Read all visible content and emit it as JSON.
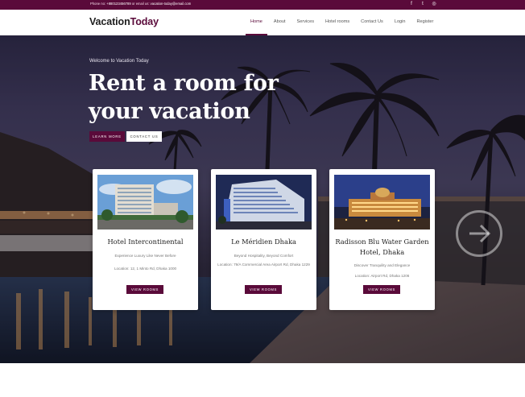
{
  "topbar": {
    "phone_label": "Phone no:",
    "phone": "+880123456789",
    "email_label": "or email us:",
    "email": "vacation-today@email.com",
    "socials": [
      {
        "icon": "facebook-icon",
        "glyph": "f"
      },
      {
        "icon": "twitter-icon",
        "glyph": "t"
      },
      {
        "icon": "instagram-icon",
        "glyph": "◎"
      }
    ]
  },
  "nav": {
    "logo_main": "Vacation",
    "logo_accent": "Today",
    "items": [
      "Home",
      "About",
      "Services",
      "Hotel rooms",
      "Contact Us",
      "Login",
      "Register"
    ],
    "active": "Home"
  },
  "hero": {
    "welcome": "Welcome to Vacation Today",
    "headline_line1": "Rent a room for",
    "headline_line2": "your vacation",
    "learn_more": "LEARN MORE",
    "contact_us": "CONTACT US",
    "next_icon": "arrow-right-circle-icon"
  },
  "cards": [
    {
      "title": "Hotel Intercontinental",
      "tagline": "Experience Luxury Like Never Before",
      "location": "Location: 12, 1 Minto Rd, Dhaka 1000",
      "button": "VIEW ROOMS"
    },
    {
      "title": "Le Méridien Dhaka",
      "tagline": "Beyond Hospitality, Beyond Comfort",
      "location": "Location: 79/A Commercial Area Airport Rd, Dhaka 1229",
      "button": "VIEW ROOMS"
    },
    {
      "title": "Radisson Blu Water Garden Hotel, Dhaka",
      "tagline": "Discover Tranquility and Elegance",
      "location": "Location: Airport Rd, Dhaka 1206",
      "button": "VIEW ROOMS"
    }
  ],
  "colors": {
    "brand": "#5a0a3a",
    "topbar_bg": "#5a0a3a"
  }
}
